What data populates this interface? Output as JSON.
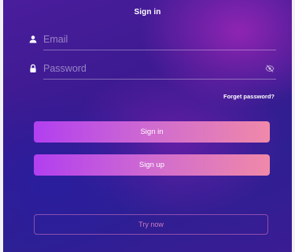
{
  "screen": {
    "title": "Sign in"
  },
  "form": {
    "email": {
      "value": "",
      "placeholder": "Email",
      "icon": "person-icon"
    },
    "password": {
      "value": "",
      "placeholder": "Password",
      "icon": "lock-icon",
      "toggle_icon": "eye-off-icon"
    },
    "forgot_label": "Forget password?"
  },
  "actions": {
    "sign_in_label": "Sign in",
    "sign_up_label": "Sign up",
    "try_now_label": "Try now"
  },
  "colors": {
    "background_top": "#4a1d9c",
    "background_bottom": "#2e1f92",
    "button_gradient_start": "#b13ff0",
    "button_gradient_end": "#f089a8",
    "outline_button_text": "#e68cc8"
  }
}
